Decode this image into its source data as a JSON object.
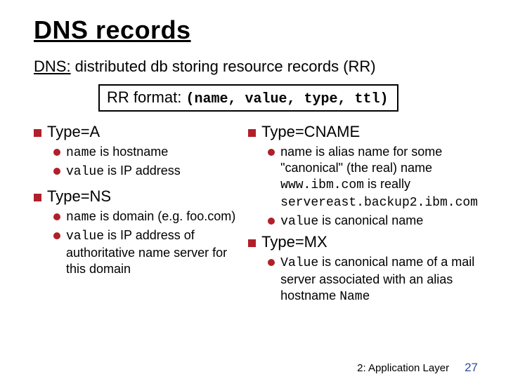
{
  "title": "DNS records",
  "subtitle_prefix": "DNS:",
  "subtitle_rest": " distributed db storing resource records (RR)",
  "format_label": "RR format: ",
  "format_tuple": "(name, value, type, ttl)",
  "typeA": {
    "heading": "Type=A",
    "b1a": "name",
    "b1b": " is hostname",
    "b2a": "value",
    "b2b": " is IP address"
  },
  "typeNS": {
    "heading": "Type=NS",
    "b1a": "name",
    "b1b": " is domain (e.g. foo.com)",
    "b2a": "value",
    "b2b": " is IP address of authoritative name server for this domain"
  },
  "typeCNAME": {
    "heading": "Type=CNAME",
    "b1a": "name is alias name for some \"canonical\" (the real) name",
    "ex1": "www.ibm.com",
    "ex_mid": " is really",
    "ex2": "servereast.backup2.ibm.com",
    "b2a": "value",
    "b2b": " is canonical name"
  },
  "typeMX": {
    "heading": "Type=MX",
    "b1a": "Value",
    "b1b": " is canonical name of a mail server associated with an alias hostname ",
    "b1c": "Name"
  },
  "footer_section": "2: Application Layer",
  "footer_page": "27"
}
